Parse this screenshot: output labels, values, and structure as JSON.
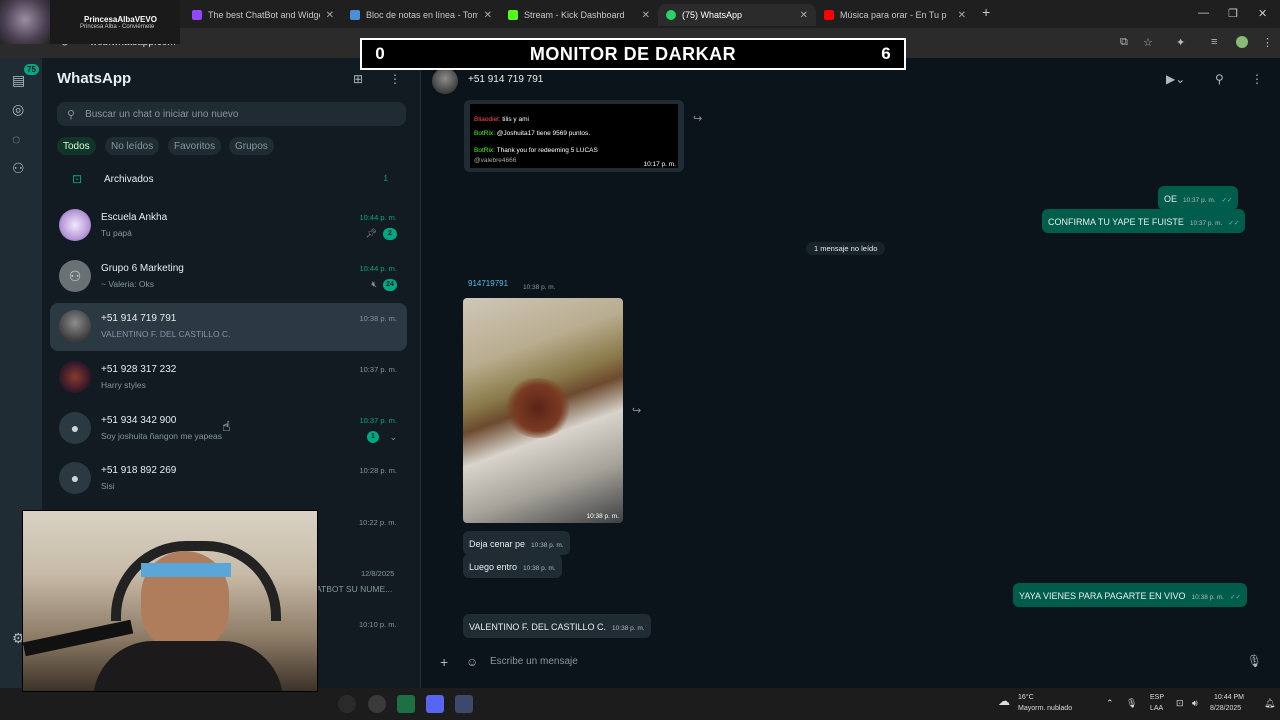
{
  "browser": {
    "tabs": [
      {
        "label": "The best ChatBot and Widgets",
        "icon": "twitch-icon",
        "color": "#9146ff"
      },
      {
        "label": "Bloc de notas en línea - Toma y",
        "icon": "notepad-icon",
        "color": "#4a90d9"
      },
      {
        "label": "Stream - Kick Dashboard",
        "icon": "kick-icon",
        "color": "#53fc18"
      },
      {
        "label": "(75) WhatsApp",
        "icon": "whatsapp-icon",
        "color": "#25d366"
      },
      {
        "label": "Música para orar - En Tu p",
        "icon": "youtube-icon",
        "color": "#ff0000"
      }
    ],
    "url": "web.whatsapp.com"
  },
  "overlay": {
    "streamer_name": "PrincesaAlbaVEVO",
    "streamer_sub": "Princesa Alba - Conviérnete",
    "monitor_title": "MONITOR DE DARKAR",
    "monitor_left": "0",
    "monitor_right": "6"
  },
  "rail": {
    "badge": "75"
  },
  "sidebar": {
    "title": "WhatsApp",
    "search_placeholder": "Buscar un chat o iniciar uno nuevo",
    "filters": [
      "Todos",
      "No leídos",
      "Favoritos",
      "Grupos"
    ],
    "archived_label": "Archivados",
    "archived_count": "1",
    "chats": [
      {
        "name": "Escuela Ankha",
        "preview": "Tu papá",
        "time": "10:44 p. m.",
        "badge": "2",
        "unread": true
      },
      {
        "name": "Grupo 6 Marketing",
        "preview": "~ Valeria: Oks",
        "time": "10:44 p. m.",
        "badge": "24",
        "unread": true
      },
      {
        "name": "+51 914 719 791",
        "preview": "VALENTINO F. DEL CASTILLO C.",
        "time": "10:38 p. m.",
        "badge": "",
        "unread": false
      },
      {
        "name": "+51 928 317 232",
        "preview": "Harry styles",
        "time": "10:37 p. m.",
        "badge": "",
        "unread": false
      },
      {
        "name": "+51 934 342 900",
        "preview": "Soy joshuita ñangon me yapeas",
        "time": "10:37 p. m.",
        "badge": "1",
        "unread": true
      },
      {
        "name": "+51 918 892 269",
        "preview": "Sisi",
        "time": "10:28 p. m.",
        "badge": "",
        "unread": false
      }
    ],
    "hidden_times": [
      "10:22 p. m.",
      "12/8/2025",
      "10:10 p. m."
    ],
    "hidden_preview": "ATBOT SU NUME..."
  },
  "chat": {
    "header_name": "+51 914 719 791",
    "bot_lines": [
      {
        "user": "Bliaodiel:",
        "text": "tilis y ami",
        "ucolor": "#ff4d4d"
      },
      {
        "user": "BotRix:",
        "text": "@Joshuita17 tiene 9569 puntos.",
        "ucolor": "#53fc18"
      },
      {
        "user": "BotRix:",
        "text": "Thank you for redeeming 5 LUCAS",
        "ucolor": "#53fc18"
      },
      {
        "user": "",
        "text": "@valebre4666",
        "ucolor": "#aaaaaa"
      }
    ],
    "bot_time": "10:17 p. m.",
    "out_messages": [
      {
        "text": "OE",
        "time": "10:37 p. m."
      },
      {
        "text": "CONFIRMA TU YAPE TE FUISTE",
        "time": "10:37 p. m."
      }
    ],
    "unread_divider": "1 mensaje no leído",
    "sender": "914719791",
    "sender_time": "10:38 p. m.",
    "photo_time": "10:38 p. m.",
    "in_messages": [
      {
        "text": "Deja cenar pe",
        "time": "10:38 p. m."
      },
      {
        "text": "Luego entro",
        "time": "10:38 p. m."
      }
    ],
    "out_last": {
      "text": "YAYA VIENES PARA PAGARTE EN VIVO",
      "time": "10:38 p. m."
    },
    "in_last": {
      "text": "VALENTINO F. DEL CASTILLO C.",
      "time": "10:38 p. m."
    },
    "composer_placeholder": "Escribe un mensaje"
  },
  "taskbar": {
    "weather_temp": "16°C",
    "weather_desc": "Mayorm. nublado",
    "lang": "ESP",
    "lang2": "LAA",
    "time": "10:44 PM",
    "date": "8/28/2025"
  },
  "colors": {
    "accent": "#00a884",
    "outgoing": "#005c4b",
    "incoming": "#202c33",
    "panel": "#111b21"
  }
}
